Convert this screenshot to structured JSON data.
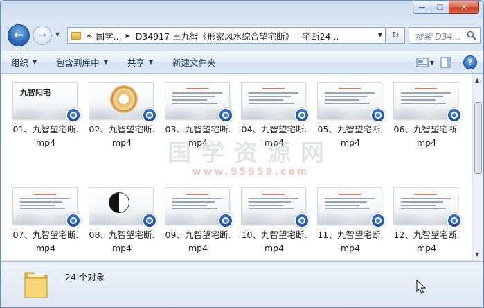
{
  "window": {
    "caption_buttons": {
      "minimize": "—",
      "maximize": "□",
      "close": "✕"
    }
  },
  "nav": {
    "back_icon": "arrow-left-icon",
    "forward_icon": "arrow-right-icon"
  },
  "address": {
    "overflow_marker": "«",
    "segments": [
      "国学...",
      "D34917 王九智《形家风水综合望宅断》—宅断24..."
    ]
  },
  "search": {
    "placeholder": "搜索 D34..."
  },
  "toolbar": {
    "organize": "组织",
    "include_library": "包含到库中",
    "share": "共享",
    "new_folder": "新建文件夹"
  },
  "files": [
    {
      "name": "01、九智望宅断.mp4",
      "line1": "01、九智望宅断.",
      "line2": "mp4",
      "thumb": "九智阳宅"
    },
    {
      "name": "02、九智望宅断.mp4",
      "line1": "02、九智望宅断.",
      "line2": "mp4",
      "thumb": ""
    },
    {
      "name": "03、九智望宅断.mp4",
      "line1": "03、九智望宅断.",
      "line2": "mp4",
      "thumb": ""
    },
    {
      "name": "04、九智望宅断.mp4",
      "line1": "04、九智望宅断.",
      "line2": "mp4",
      "thumb": ""
    },
    {
      "name": "05、九智望宅断.mp4",
      "line1": "05、九智望宅断.",
      "line2": "mp4",
      "thumb": ""
    },
    {
      "name": "06、九智望宅断.mp4",
      "line1": "06、九智望宅断.",
      "line2": "mp4",
      "thumb": ""
    },
    {
      "name": "07、九智望宅断.mp4",
      "line1": "07、九智望宅断.",
      "line2": "mp4",
      "thumb": ""
    },
    {
      "name": "08、九智望宅断.mp4",
      "line1": "08、九智望宅断.",
      "line2": "mp4",
      "thumb": ""
    },
    {
      "name": "09、九智望宅断.mp4",
      "line1": "09、九智望宅断.",
      "line2": "mp4",
      "thumb": ""
    },
    {
      "name": "10、九智望宅断.mp4",
      "line1": "10、九智望宅断.",
      "line2": "mp4",
      "thumb": ""
    },
    {
      "name": "11、九智望宅断.mp4",
      "line1": "11、九智望宅断.",
      "line2": "mp4",
      "thumb": ""
    },
    {
      "name": "12、九智望宅断.mp4",
      "line1": "12、九智望宅断.",
      "line2": "mp4",
      "thumb": ""
    }
  ],
  "watermark": {
    "title": "国学资源网",
    "url": "www.95959.com"
  },
  "details": {
    "count_text": "24 个对象"
  }
}
